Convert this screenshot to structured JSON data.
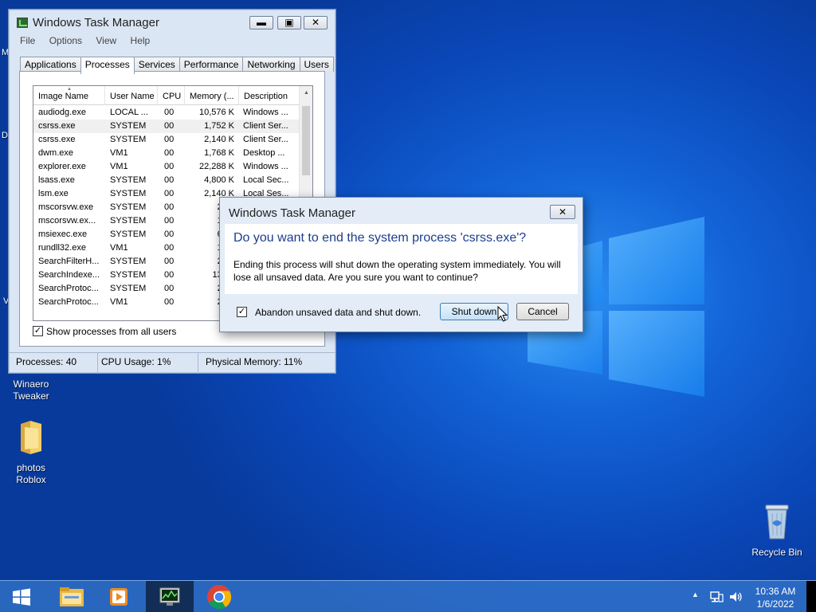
{
  "desktop": {
    "icons": [
      {
        "label_line1": "Winaero",
        "label_line2": "Tweaker"
      },
      {
        "label_line1": "photos",
        "label_line2": "Roblox"
      },
      {
        "label_line1": "Recycle Bin",
        "label_line2": ""
      }
    ],
    "edge_letters": [
      "M",
      "D",
      "V"
    ]
  },
  "task_manager": {
    "title": "Windows Task Manager",
    "menu": [
      "File",
      "Options",
      "View",
      "Help"
    ],
    "tabs": [
      "Applications",
      "Processes",
      "Services",
      "Performance",
      "Networking",
      "Users"
    ],
    "active_tab": "Processes",
    "columns": [
      "Image Name",
      "User Name",
      "CPU",
      "Memory (...",
      "Description"
    ],
    "rows": [
      {
        "image": "audiodg.exe",
        "user": "LOCAL ...",
        "cpu": "00",
        "mem": "10,576 K",
        "desc": "Windows ..."
      },
      {
        "image": "csrss.exe",
        "user": "SYSTEM",
        "cpu": "00",
        "mem": "1,752 K",
        "desc": "Client Ser..."
      },
      {
        "image": "csrss.exe",
        "user": "SYSTEM",
        "cpu": "00",
        "mem": "2,140 K",
        "desc": "Client Ser..."
      },
      {
        "image": "dwm.exe",
        "user": "VM1",
        "cpu": "00",
        "mem": "1,768 K",
        "desc": "Desktop ..."
      },
      {
        "image": "explorer.exe",
        "user": "VM1",
        "cpu": "00",
        "mem": "22,288 K",
        "desc": "Windows ..."
      },
      {
        "image": "lsass.exe",
        "user": "SYSTEM",
        "cpu": "00",
        "mem": "4,800 K",
        "desc": "Local Sec..."
      },
      {
        "image": "lsm.exe",
        "user": "SYSTEM",
        "cpu": "00",
        "mem": "2,140 K",
        "desc": "Local Ses..."
      },
      {
        "image": "mscorsvw.exe",
        "user": "SYSTEM",
        "cpu": "00",
        "mem": "2,51",
        "desc": ""
      },
      {
        "image": "mscorsvw.ex...",
        "user": "SYSTEM",
        "cpu": "00",
        "mem": "1,72",
        "desc": ""
      },
      {
        "image": "msiexec.exe",
        "user": "SYSTEM",
        "cpu": "00",
        "mem": "6,21",
        "desc": ""
      },
      {
        "image": "rundll32.exe",
        "user": "VM1",
        "cpu": "00",
        "mem": "1,82",
        "desc": ""
      },
      {
        "image": "SearchFilterH...",
        "user": "SYSTEM",
        "cpu": "00",
        "mem": "2,32",
        "desc": ""
      },
      {
        "image": "SearchIndexe...",
        "user": "SYSTEM",
        "cpu": "00",
        "mem": "13,81",
        "desc": ""
      },
      {
        "image": "SearchProtoc...",
        "user": "SYSTEM",
        "cpu": "00",
        "mem": "2,52",
        "desc": ""
      },
      {
        "image": "SearchProtoc...",
        "user": "VM1",
        "cpu": "00",
        "mem": "2,08",
        "desc": ""
      }
    ],
    "show_all_label": "Show processes from all users",
    "status": {
      "processes": "Processes: 40",
      "cpu": "CPU Usage: 1%",
      "memory": "Physical Memory: 11%"
    }
  },
  "dialog": {
    "title": "Windows Task Manager",
    "close": "✕",
    "main_instruction": "Do you want to end the system process 'csrss.exe'?",
    "content": "Ending this process will shut down the operating system immediately.  You will lose all unsaved data.  Are you sure you want to continue?",
    "checkbox_label": "Abandon unsaved data and shut down.",
    "shutdown_label": "Shut down",
    "cancel_label": "Cancel"
  },
  "taskbar": {
    "time": "10:36 AM",
    "date": "1/6/2022",
    "tray_chevron": "▲"
  },
  "colors": {
    "accent": "#1c3d8f",
    "taskbar": "#468cdc"
  }
}
